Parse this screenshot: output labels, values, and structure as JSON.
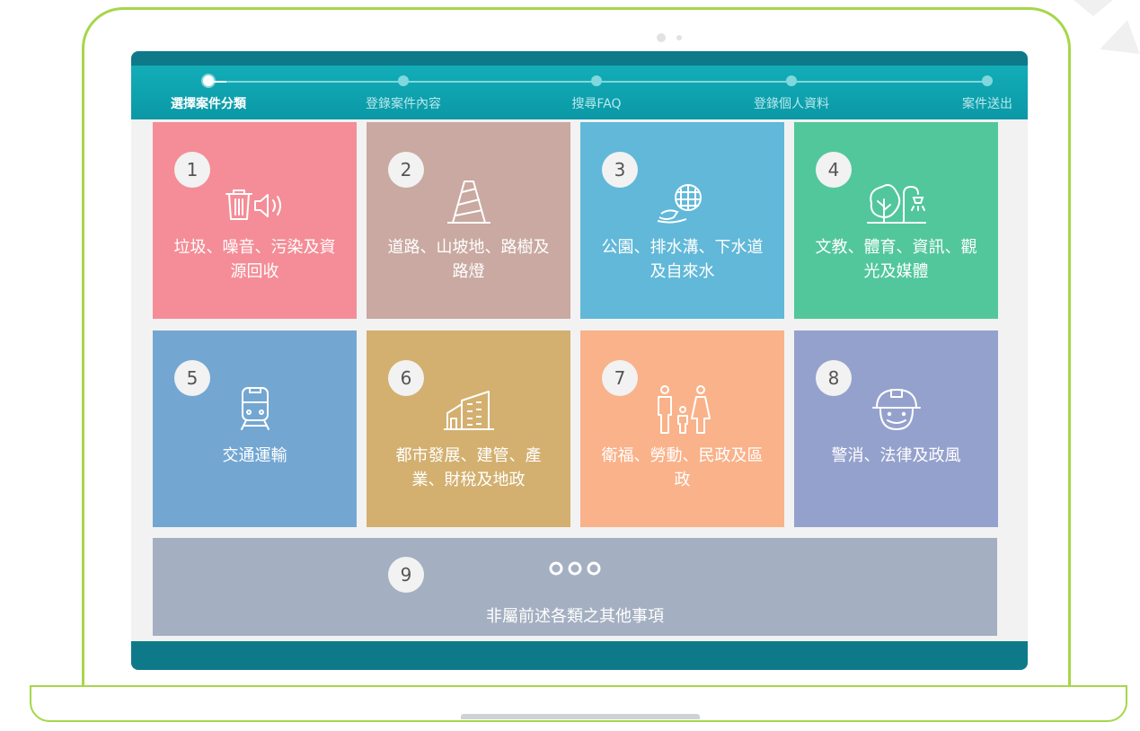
{
  "steps": [
    {
      "label": "選擇案件分類",
      "active": true
    },
    {
      "label": "登錄案件內容",
      "active": false
    },
    {
      "label": "搜尋FAQ",
      "active": false
    },
    {
      "label": "登錄個人資料",
      "active": false
    },
    {
      "label": "案件送出",
      "active": false
    }
  ],
  "categories": [
    {
      "number": "1",
      "title": "垃圾、噪音、污染及資源回收",
      "color": "#f48d97",
      "icon": "trash-noise-icon"
    },
    {
      "number": "2",
      "title": "道路、山坡地、路樹及路燈",
      "color": "#c9a9a1",
      "icon": "traffic-cone-icon"
    },
    {
      "number": "3",
      "title": "公園、排水溝、下水道及自來水",
      "color": "#61b8d8",
      "icon": "drain-water-icon"
    },
    {
      "number": "4",
      "title": "文教、體育、資訊、觀光及媒體",
      "color": "#52c79b",
      "icon": "tree-lamp-icon"
    },
    {
      "number": "5",
      "title": "交通運輸",
      "color": "#73a7d2",
      "icon": "train-icon"
    },
    {
      "number": "6",
      "title": "都市發展、建管、產業、財稅及地政",
      "color": "#d3b06f",
      "icon": "building-icon"
    },
    {
      "number": "7",
      "title": "衛福、勞動、民政及區政",
      "color": "#f9b28a",
      "icon": "family-icon"
    },
    {
      "number": "8",
      "title": "警消、法律及政風",
      "color": "#95a1cd",
      "icon": "helmet-worker-icon"
    },
    {
      "number": "9",
      "title": "非屬前述各類之其他事項",
      "color": "#a4afc1",
      "icon": "more-dots-icon"
    }
  ]
}
